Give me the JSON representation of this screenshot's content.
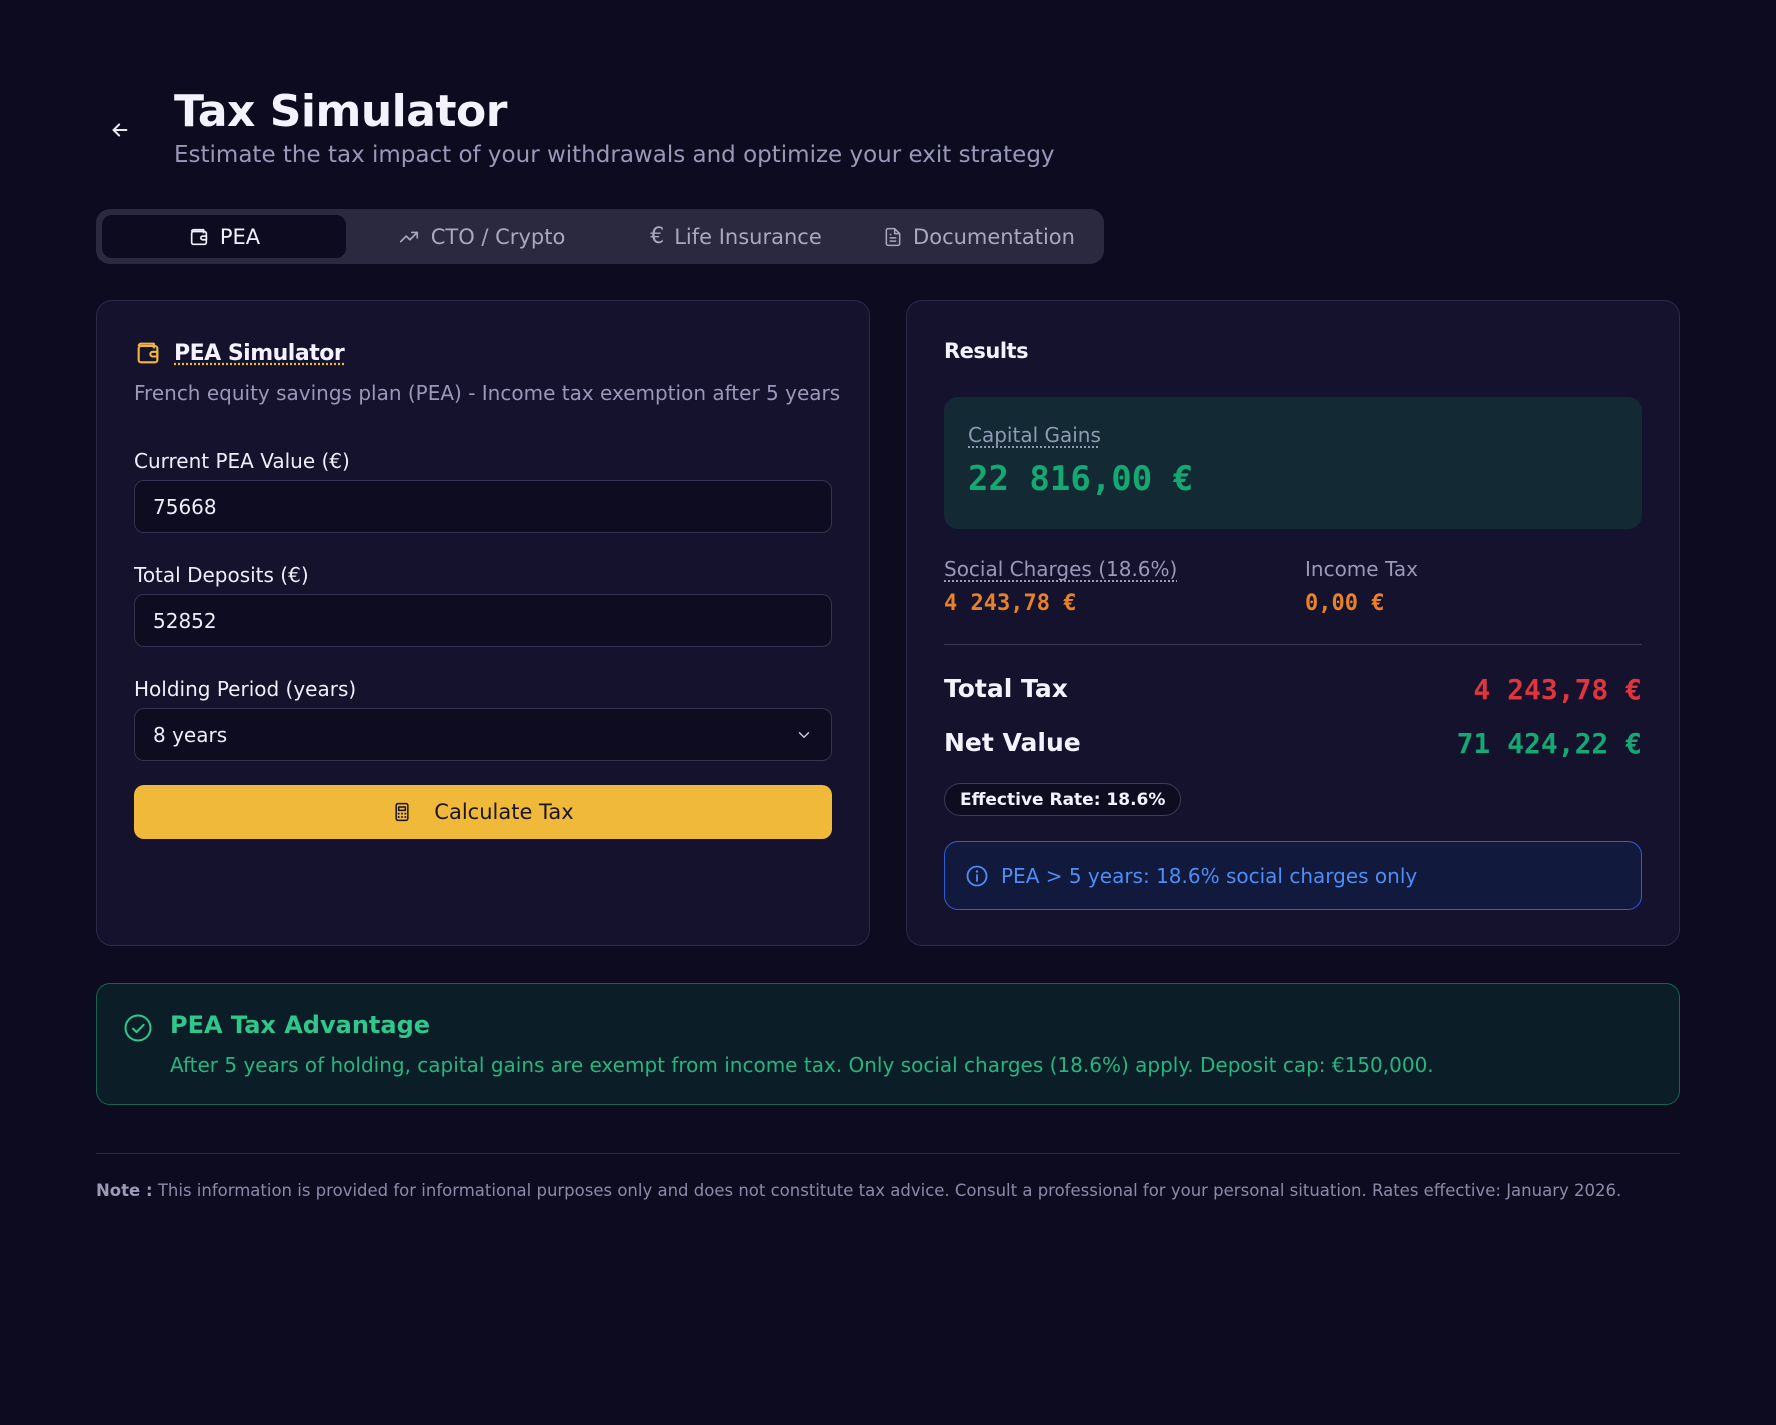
{
  "header": {
    "back_icon": "arrow-left-icon",
    "title": "Tax Simulator",
    "subtitle": "Estimate the tax impact of your withdrawals and optimize your exit strategy"
  },
  "tabs": [
    {
      "label": "PEA",
      "icon": "wallet-icon",
      "active": true
    },
    {
      "label": "CTO / Crypto",
      "icon": "trending-up-icon",
      "active": false
    },
    {
      "label": "Life Insurance",
      "icon": "euro-icon",
      "active": false
    },
    {
      "label": "Documentation",
      "icon": "document-icon",
      "active": false
    }
  ],
  "simulator": {
    "title": "PEA Simulator",
    "description": "French equity savings plan (PEA) - Income tax exemption after 5 years",
    "fields": {
      "current_value": {
        "label": "Current PEA Value (€)",
        "value": "75668"
      },
      "deposits": {
        "label": "Total Deposits (€)",
        "value": "52852"
      },
      "holding": {
        "label": "Holding Period (years)",
        "value": "8 years"
      }
    },
    "calculate_label": "Calculate Tax"
  },
  "results": {
    "title": "Results",
    "capital_gains": {
      "label": "Capital Gains",
      "value": "22 816,00 €"
    },
    "social_charges": {
      "label": "Social Charges (18.6%)",
      "value": "4 243,78 €"
    },
    "income_tax": {
      "label": "Income Tax",
      "value": "0,00 €"
    },
    "total_tax": {
      "label": "Total Tax",
      "value": "4 243,78 €"
    },
    "net_value": {
      "label": "Net Value",
      "value": "71 424,22 €"
    },
    "effective_rate": "Effective Rate: 18.6%",
    "info": "PEA > 5 years: 18.6% social charges only"
  },
  "advantage": {
    "title": "PEA Tax Advantage",
    "text": "After 5 years of holding, capital gains are exempt from income tax. Only social charges (18.6%) apply. Deposit cap: €150,000."
  },
  "footer": {
    "note_label": "Note :",
    "note_text": " This information is provided for informational purposes only and does not constitute tax advice. Consult a professional for your personal situation. Rates effective: January 2026."
  },
  "colors": {
    "background": "#0c0b1f",
    "card": "#14122d",
    "accent_yellow": "#f0b93a",
    "gain_green": "#14a873",
    "charge_orange": "#e7822a",
    "tax_red": "#e0343f",
    "info_blue": "#4f8df6"
  }
}
